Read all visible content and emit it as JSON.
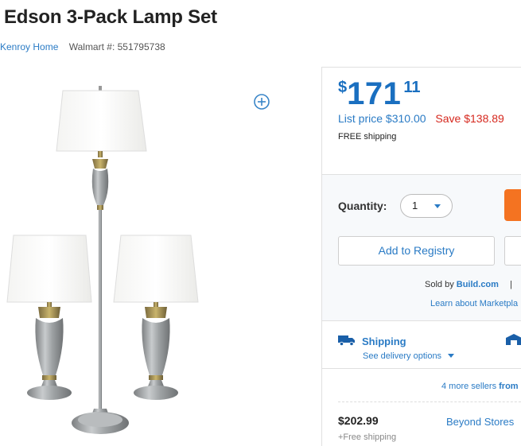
{
  "product": {
    "title": "Edson 3-Pack Lamp Set",
    "brand": "Kenroy Home",
    "walmart_number": "Walmart #: 551795738"
  },
  "image": {
    "alt": "lamp set product image",
    "zoom_icon": "plus-circle-icon"
  },
  "pricing": {
    "currency": "$",
    "dollars": "171",
    "cents": "11",
    "list_price": "List price $310.00",
    "save": "Save $138.89",
    "free_shipping": "FREE shipping"
  },
  "purchase": {
    "quantity_label": "Quantity:",
    "quantity_value": "1",
    "add_to_registry": "Add to Registry"
  },
  "seller": {
    "sold_by_prefix": "Sold by",
    "seller_name": "Build.com",
    "separator": "|",
    "learn_more": "Learn about Marketpla"
  },
  "shipping": {
    "title": "Shipping",
    "delivery_options": "See delivery options",
    "icon": "truck-icon"
  },
  "other_sellers": {
    "more_sellers_prefix": "4 more sellers",
    "more_sellers_suffix": "from",
    "offer_price": "$202.99",
    "offer_shipping": "+Free shipping",
    "offer_seller": "Beyond Stores"
  },
  "colors": {
    "accent_blue": "#2a7bc5",
    "price_blue": "#1a6fc0",
    "save_red": "#d6281e",
    "cart_orange": "#f47321"
  }
}
